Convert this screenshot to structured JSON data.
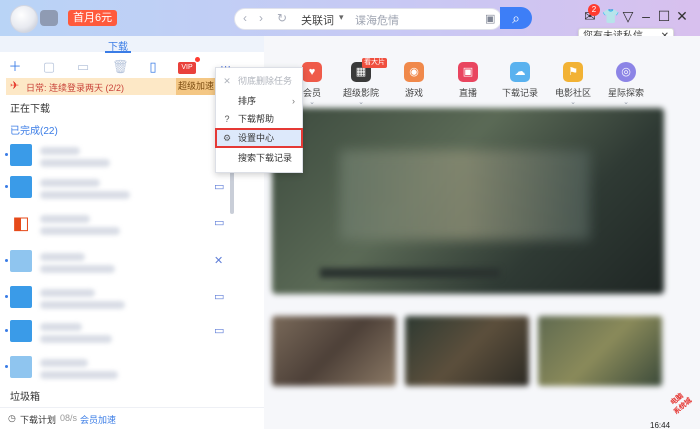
{
  "header": {
    "promo": "首月6元",
    "address": {
      "back": "‹",
      "forward": "›",
      "refresh": "↻",
      "keyword": "关联词",
      "keyword_caret": "▾",
      "placeholder": "谍海危情"
    },
    "search_icon": "⌕",
    "notification_count": "2",
    "tooltip": {
      "text": "您有未读私信",
      "close": "✕"
    }
  },
  "left_panel": {
    "tab": "下载",
    "notice": {
      "text": "日常: 连续登录两天 (2/2)",
      "button": "超级加速"
    },
    "downloading": "正在下载",
    "completed": "已完成(22)",
    "trash": "垃圾箱",
    "footer": {
      "plan": "下载计划",
      "speed": "08/s",
      "accelerate": "会员加速"
    }
  },
  "context_menu": {
    "items": [
      {
        "label": "彻底删除任务",
        "icon": "✕",
        "disabled": true
      },
      {
        "label": "排序",
        "icon": "",
        "arrow": "›"
      },
      {
        "label": "下载帮助",
        "icon": "?"
      },
      {
        "label": "设置中心",
        "icon": "⚙",
        "highlighted": true
      },
      {
        "label": "搜索下载记录",
        "icon": ""
      }
    ]
  },
  "categories": [
    {
      "label": "会员",
      "color": "#ef5b4a"
    },
    {
      "label": "超级影院",
      "color": "#3a3a3a",
      "tag": "看大片"
    },
    {
      "label": "游戏",
      "color": "#f0894b"
    },
    {
      "label": "直播",
      "color": "#e9455f"
    },
    {
      "label": "下载记录",
      "color": "#5ab2ef"
    },
    {
      "label": "电影社区",
      "color": "#f2b234"
    },
    {
      "label": "星际探索",
      "color": "#8c84e6"
    }
  ],
  "clock": "16:44",
  "watermark": "电脑系统城"
}
